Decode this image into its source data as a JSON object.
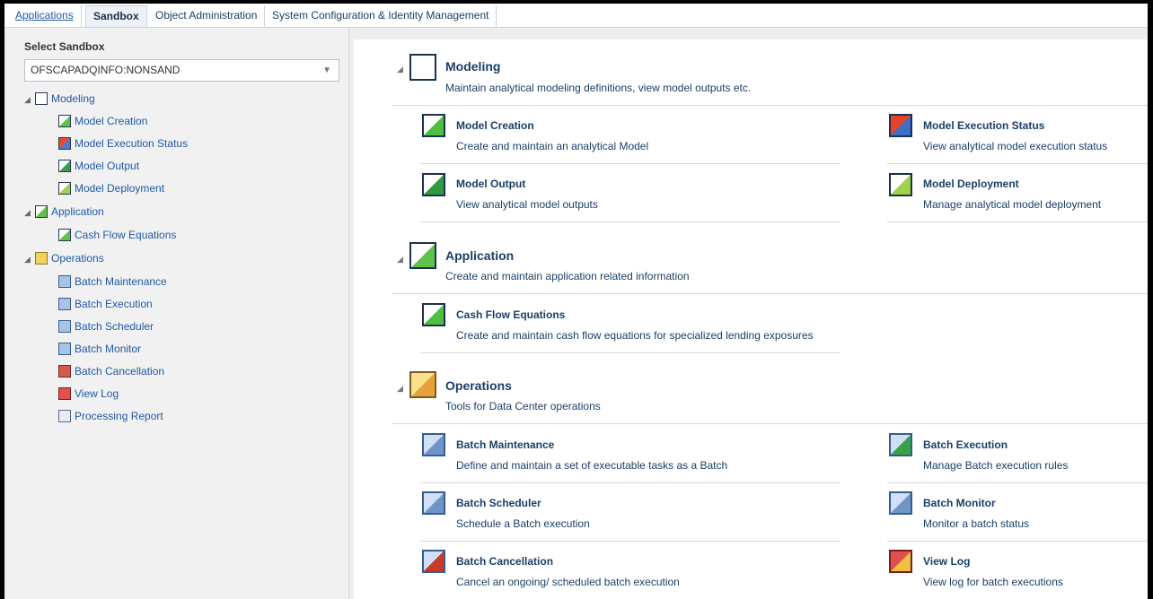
{
  "tabs": [
    {
      "label": "Applications",
      "style": "link"
    },
    {
      "label": "Sandbox",
      "style": "active"
    },
    {
      "label": "Object Administration",
      "style": "normal"
    },
    {
      "label": "System Configuration & Identity Management",
      "style": "normal"
    }
  ],
  "left_panel": {
    "title": "Select Sandbox",
    "sandbox_value": "OFSCAPADQINFO:NONSAND",
    "dropdown_arrow": "▼",
    "tree": [
      {
        "label": "Modeling",
        "level": 0,
        "icon": "modeling-icon"
      },
      {
        "label": "Model Creation",
        "level": 1,
        "icon": "model-creation-icon"
      },
      {
        "label": "Model Execution Status",
        "level": 1,
        "icon": "model-execution-status-icon"
      },
      {
        "label": "Model Output",
        "level": 1,
        "icon": "model-output-icon"
      },
      {
        "label": "Model Deployment",
        "level": 1,
        "icon": "model-deployment-icon"
      },
      {
        "label": "Application",
        "level": 0,
        "icon": "application-icon"
      },
      {
        "label": "Cash Flow Equations",
        "level": 1,
        "icon": "cash-flow-equations-icon"
      },
      {
        "label": "Operations",
        "level": 0,
        "icon": "operations-icon"
      },
      {
        "label": "Batch Maintenance",
        "level": 1,
        "icon": "batch-maintenance-icon"
      },
      {
        "label": "Batch Execution",
        "level": 1,
        "icon": "batch-execution-icon"
      },
      {
        "label": "Batch Scheduler",
        "level": 1,
        "icon": "batch-scheduler-icon"
      },
      {
        "label": "Batch Monitor",
        "level": 1,
        "icon": "batch-monitor-icon"
      },
      {
        "label": "Batch Cancellation",
        "level": 1,
        "icon": "batch-cancellation-icon"
      },
      {
        "label": "View Log",
        "level": 1,
        "icon": "view-log-icon"
      },
      {
        "label": "Processing Report",
        "level": 1,
        "icon": "processing-report-icon"
      }
    ]
  },
  "sections": {
    "modeling": {
      "title": "Modeling",
      "description": "Maintain analytical modeling definitions, view model outputs etc.",
      "items": [
        {
          "title": "Model Creation",
          "description": "Create and maintain an analytical Model"
        },
        {
          "title": "Model Execution Status",
          "description": "View analytical model execution status"
        },
        {
          "title": "Model Output",
          "description": "View analytical model outputs"
        },
        {
          "title": "Model Deployment",
          "description": "Manage analytical model deployment"
        }
      ]
    },
    "application": {
      "title": "Application",
      "description": "Create and maintain application related information",
      "items": [
        {
          "title": "Cash Flow Equations",
          "description": "Create and maintain cash flow equations for specialized lending exposures"
        }
      ]
    },
    "operations": {
      "title": "Operations",
      "description": "Tools for Data Center operations",
      "items": [
        {
          "title": "Batch Maintenance",
          "description": "Define and maintain a set of executable tasks as a Batch"
        },
        {
          "title": "Batch Execution",
          "description": "Manage Batch execution rules"
        },
        {
          "title": "Batch Scheduler",
          "description": "Schedule a Batch execution"
        },
        {
          "title": "Batch Monitor",
          "description": "Monitor a batch status"
        },
        {
          "title": "Batch Cancellation",
          "description": "Cancel an ongoing/ scheduled batch execution"
        },
        {
          "title": "View Log",
          "description": "View log for batch executions"
        }
      ]
    }
  }
}
